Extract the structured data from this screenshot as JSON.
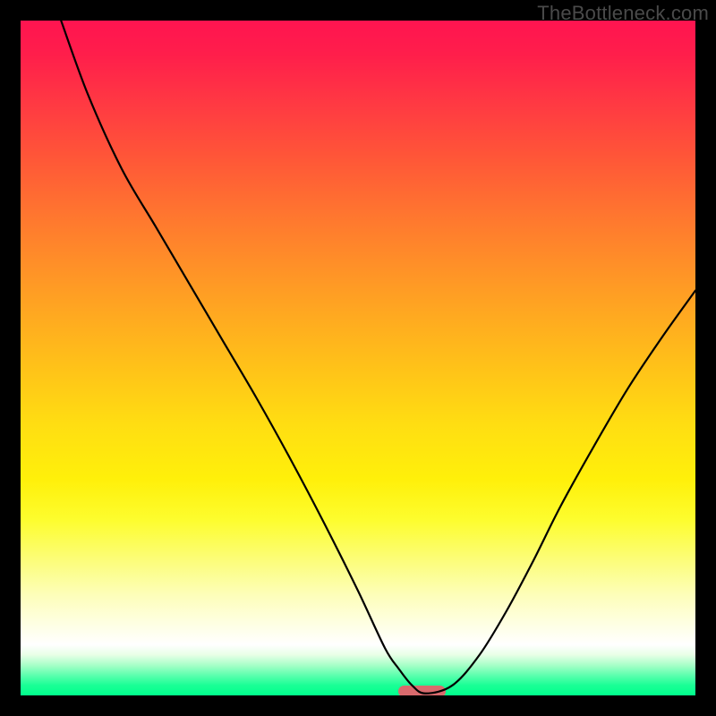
{
  "watermark": "TheBottleneck.com",
  "chart_data": {
    "type": "line",
    "title": "",
    "xlabel": "",
    "ylabel": "",
    "xlim": [
      0,
      100
    ],
    "ylim": [
      0,
      100
    ],
    "grid": false,
    "legend": false,
    "gradient_stops": [
      {
        "pos": 0,
        "color": "#ff1450"
      },
      {
        "pos": 12,
        "color": "#ff3843"
      },
      {
        "pos": 28,
        "color": "#ff7330"
      },
      {
        "pos": 44,
        "color": "#ffaa20"
      },
      {
        "pos": 60,
        "color": "#ffde12"
      },
      {
        "pos": 74,
        "color": "#fdfd2e"
      },
      {
        "pos": 85,
        "color": "#fdfeb8"
      },
      {
        "pos": 92.5,
        "color": "#ffffff"
      },
      {
        "pos": 95.5,
        "color": "#a8ffc8"
      },
      {
        "pos": 100,
        "color": "#00ff8c"
      }
    ],
    "series": [
      {
        "name": "curve",
        "x": [
          6,
          10,
          15,
          20,
          25,
          30,
          35,
          40,
          45,
          50,
          54,
          56,
          58,
          60,
          64,
          68,
          72,
          76,
          80,
          85,
          90,
          95,
          100
        ],
        "y": [
          100,
          89,
          78,
          69.5,
          61,
          52.5,
          44,
          35,
          25.5,
          15.5,
          7,
          4,
          1.5,
          0.3,
          1.5,
          6,
          12.5,
          20,
          28,
          37,
          45.5,
          53,
          60
        ]
      }
    ],
    "marker": {
      "shape": "pill",
      "x_center": 59.5,
      "y": 0.6,
      "width_pct": 7.0,
      "height_pct": 1.6,
      "color": "#d96a6d"
    }
  }
}
